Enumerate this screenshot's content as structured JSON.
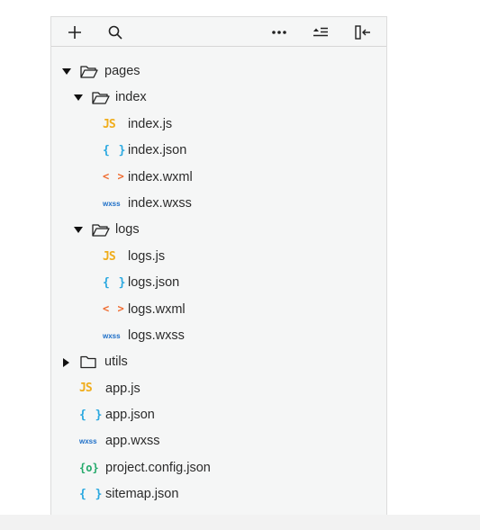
{
  "toolbar": {
    "buttons": [
      {
        "name": "add-icon"
      },
      {
        "name": "search-icon"
      },
      {
        "name": "more-icon"
      },
      {
        "name": "collapse-all-icon"
      },
      {
        "name": "hide-sidebar-icon"
      }
    ]
  },
  "tree": {
    "pages": {
      "label": "pages",
      "expanded": true
    },
    "index": {
      "label": "index",
      "expanded": true
    },
    "index_js": {
      "label": "index.js",
      "icon": "JS"
    },
    "index_json": {
      "label": "index.json",
      "icon": "{ }"
    },
    "index_wxml": {
      "label": "index.wxml",
      "icon": "< >"
    },
    "index_wxss": {
      "label": "index.wxss",
      "icon": "wxss"
    },
    "logs": {
      "label": "logs",
      "expanded": true
    },
    "logs_js": {
      "label": "logs.js",
      "icon": "JS"
    },
    "logs_json": {
      "label": "logs.json",
      "icon": "{ }"
    },
    "logs_wxml": {
      "label": "logs.wxml",
      "icon": "< >"
    },
    "logs_wxss": {
      "label": "logs.wxss",
      "icon": "wxss"
    },
    "utils": {
      "label": "utils",
      "expanded": false
    },
    "app_js": {
      "label": "app.js",
      "icon": "JS"
    },
    "app_json": {
      "label": "app.json",
      "icon": "{ }"
    },
    "app_wxss": {
      "label": "app.wxss",
      "icon": "wxss"
    },
    "project_config": {
      "label": "project.config.json",
      "icon": "{o}"
    },
    "sitemap": {
      "label": "sitemap.json",
      "icon": "{ }"
    }
  },
  "colors": {
    "js": "#f0ad1b",
    "json": "#29a8e0",
    "wxml": "#ef6b2f",
    "wxss": "#1d6fc8",
    "config": "#23a96a"
  }
}
